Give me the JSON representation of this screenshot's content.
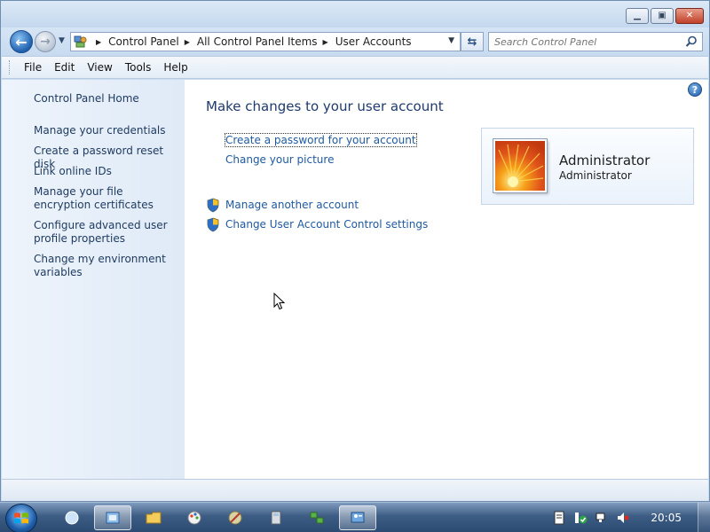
{
  "window": {
    "caption_buttons": {
      "minimize": "minimize-icon",
      "maximize": "maximize-icon",
      "close": "close-icon"
    }
  },
  "navigation": {
    "breadcrumb": [
      "Control Panel",
      "All Control Panel Items",
      "User Accounts"
    ],
    "search_placeholder": "Search Control Panel"
  },
  "menu": [
    "File",
    "Edit",
    "View",
    "Tools",
    "Help"
  ],
  "sidebar": {
    "home": "Control Panel Home",
    "links": [
      "Manage your credentials",
      "Create a password reset disk",
      "Link online IDs",
      "Manage your file encryption certificates",
      "Configure advanced user profile properties",
      "Change my environment variables"
    ]
  },
  "main": {
    "title": "Make changes to your user account",
    "tasks": [
      "Create a password for your account",
      "Change your picture"
    ],
    "admin_tasks": [
      "Manage another account",
      "Change User Account Control settings"
    ]
  },
  "user": {
    "name": "Administrator",
    "role": "Administrator"
  },
  "taskbar": {
    "clock": "20:05"
  },
  "colors": {
    "link": "#1f5aa0",
    "title": "#1e3a6e",
    "sidebar_bg": "#e6eef8"
  }
}
